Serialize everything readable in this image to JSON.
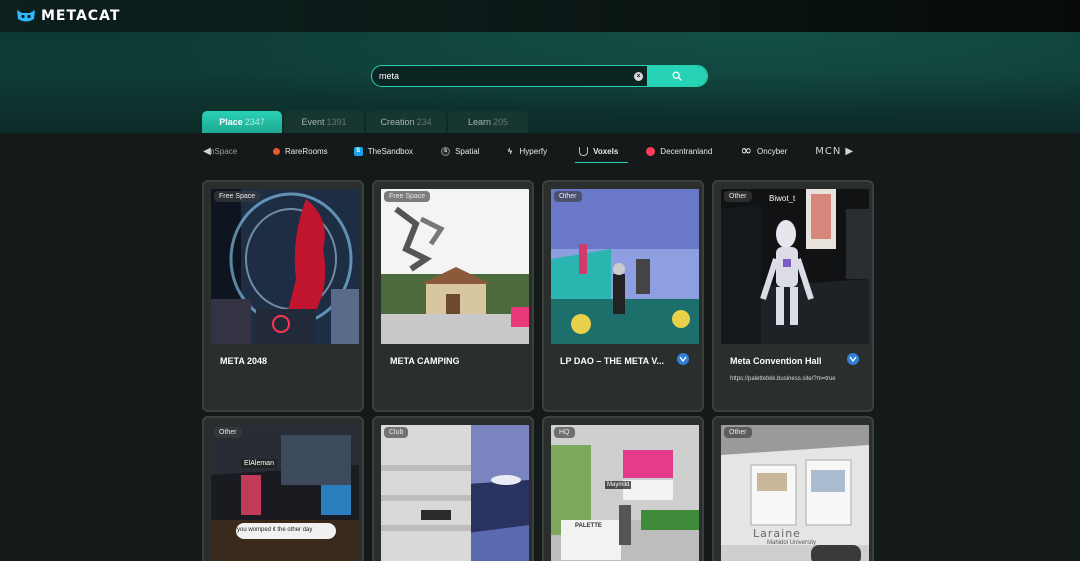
{
  "brand": {
    "name": "METACAT"
  },
  "search": {
    "value": "meta",
    "clear_icon": "close-icon",
    "button_icon": "search-icon"
  },
  "tabs": [
    {
      "label": "Place",
      "count": "2347",
      "active": true
    },
    {
      "label": "Event",
      "count": "1391",
      "active": false
    },
    {
      "label": "Creation",
      "count": "234",
      "active": false
    },
    {
      "label": "Learn",
      "count": "205",
      "active": false
    }
  ],
  "platforms": [
    {
      "label": "ZmSpace",
      "partial": true
    },
    {
      "label": "RareRooms"
    },
    {
      "label": "TheSandbox"
    },
    {
      "label": "Spatial"
    },
    {
      "label": "Hyperfy"
    },
    {
      "label": "Voxels",
      "active": true
    },
    {
      "label": "Decentranland"
    },
    {
      "label": "Oncyber"
    },
    {
      "label": "MCN",
      "partial": true
    }
  ],
  "cards": [
    {
      "badge": "Free Space",
      "title": "META 2048",
      "url": "",
      "voxels_icon": false
    },
    {
      "badge": "Free Space",
      "title": "META CAMPING",
      "url": "",
      "voxels_icon": false
    },
    {
      "badge": "Other",
      "title": "LP DAO – THE META V...",
      "url": "",
      "voxels_icon": true
    },
    {
      "badge": "Other",
      "title": "Meta Convention Hall",
      "url": "https://palettebkk.business.site/?m=true",
      "voxels_icon": true,
      "scene_label": "Biwot_t"
    },
    {
      "badge": "Other",
      "title": "",
      "scene_label": "ElAleman",
      "scene_caption": "you womped it the other day"
    },
    {
      "badge": "Club",
      "title": ""
    },
    {
      "badge": "HQ",
      "title": "",
      "scene_label": "PALETTE",
      "scene_caption": "Maymild"
    },
    {
      "badge": "Other",
      "title": "",
      "scene_label": "Laraine",
      "scene_caption": "Mahidol University"
    }
  ],
  "colors": {
    "accent": "#2ad1b6",
    "card_bg": "#2a2e2d",
    "page_bg": "#141a19"
  }
}
